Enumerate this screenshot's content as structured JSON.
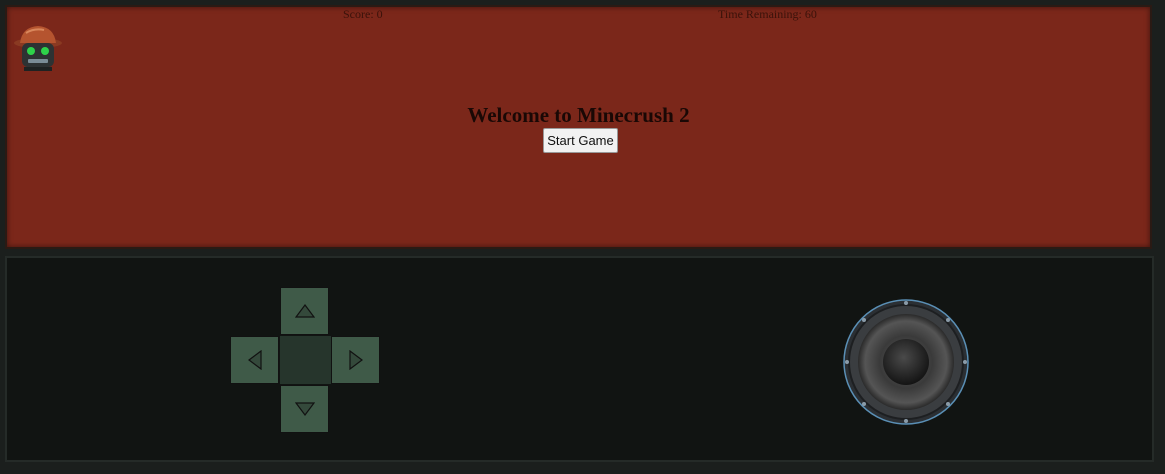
{
  "hud": {
    "score_text": "Score: 0",
    "time_text": "Time Remaining: 60"
  },
  "menu": {
    "title": "Welcome to Minecrush 2",
    "start_label": "Start Game"
  },
  "icons": {
    "avatar": "miner-robot-icon",
    "up": "arrow-up-icon",
    "down": "arrow-down-icon",
    "left": "arrow-left-icon",
    "right": "arrow-right-icon",
    "speaker": "speaker-icon"
  },
  "colors": {
    "game_background": "#7b271a",
    "controls_background": "#111412",
    "dpad": "#3f5a48",
    "dpad_center": "#26352c"
  }
}
